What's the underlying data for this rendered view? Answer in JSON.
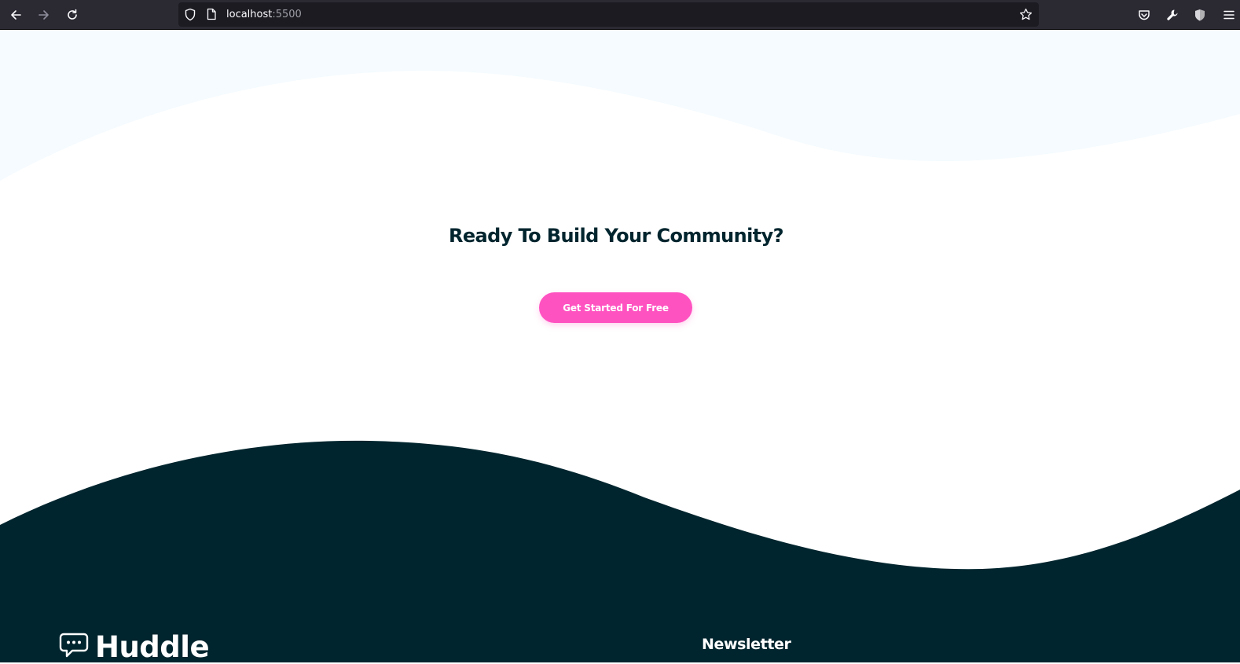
{
  "browser": {
    "url_host": "localhost",
    "url_port": ":5500",
    "icons": {
      "back": "arrow-left-icon",
      "forward": "arrow-right-icon",
      "reload": "reload-icon",
      "tracking": "shield-icon",
      "page": "page-icon",
      "bookmark": "star-icon",
      "pocket": "pocket-icon",
      "tools": "wrench-icon",
      "extension": "shield-extension-icon",
      "menu": "hamburger-menu-icon"
    }
  },
  "cta": {
    "title": "Ready To Build Your Community?",
    "button_label": "Get Started For Free"
  },
  "footer": {
    "logo_text": "Huddle",
    "newsletter_heading": "Newsletter"
  },
  "colors": {
    "toolbar_bg": "#2b2a33",
    "urlbar_bg": "#1c1b22",
    "light_wave": "#f5fbff",
    "dark_navy": "#00252e",
    "pink": "#ff52c1",
    "white": "#ffffff"
  }
}
